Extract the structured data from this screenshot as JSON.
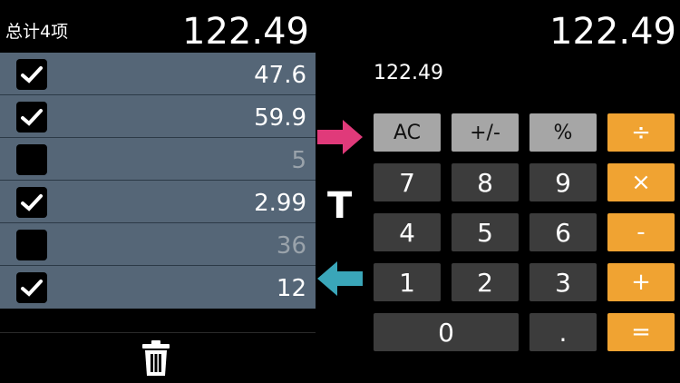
{
  "list": {
    "count_label": "总计4项",
    "total": "122.49",
    "items": [
      {
        "value": "47.6",
        "checked": true
      },
      {
        "value": "59.9",
        "checked": true
      },
      {
        "value": "5",
        "checked": false
      },
      {
        "value": "2.99",
        "checked": true
      },
      {
        "value": "36",
        "checked": false
      },
      {
        "value": "12",
        "checked": true
      }
    ]
  },
  "calculator": {
    "display": "122.49",
    "expression": "122.49",
    "buttons": {
      "ac": "AC",
      "sign": "+/-",
      "percent": "%",
      "divide": "÷",
      "seven": "7",
      "eight": "8",
      "nine": "9",
      "multiply": "×",
      "four": "4",
      "five": "5",
      "six": "6",
      "minus": "-",
      "one": "1",
      "two": "2",
      "three": "3",
      "plus": "+",
      "zero": "0",
      "dot": ".",
      "equals": "="
    }
  },
  "middle": {
    "mark": "T"
  },
  "colors": {
    "accent_orange": "#f0a332",
    "arrow_pink": "#e03a7a",
    "arrow_teal": "#3aa6b9",
    "list_bg": "#556677"
  }
}
